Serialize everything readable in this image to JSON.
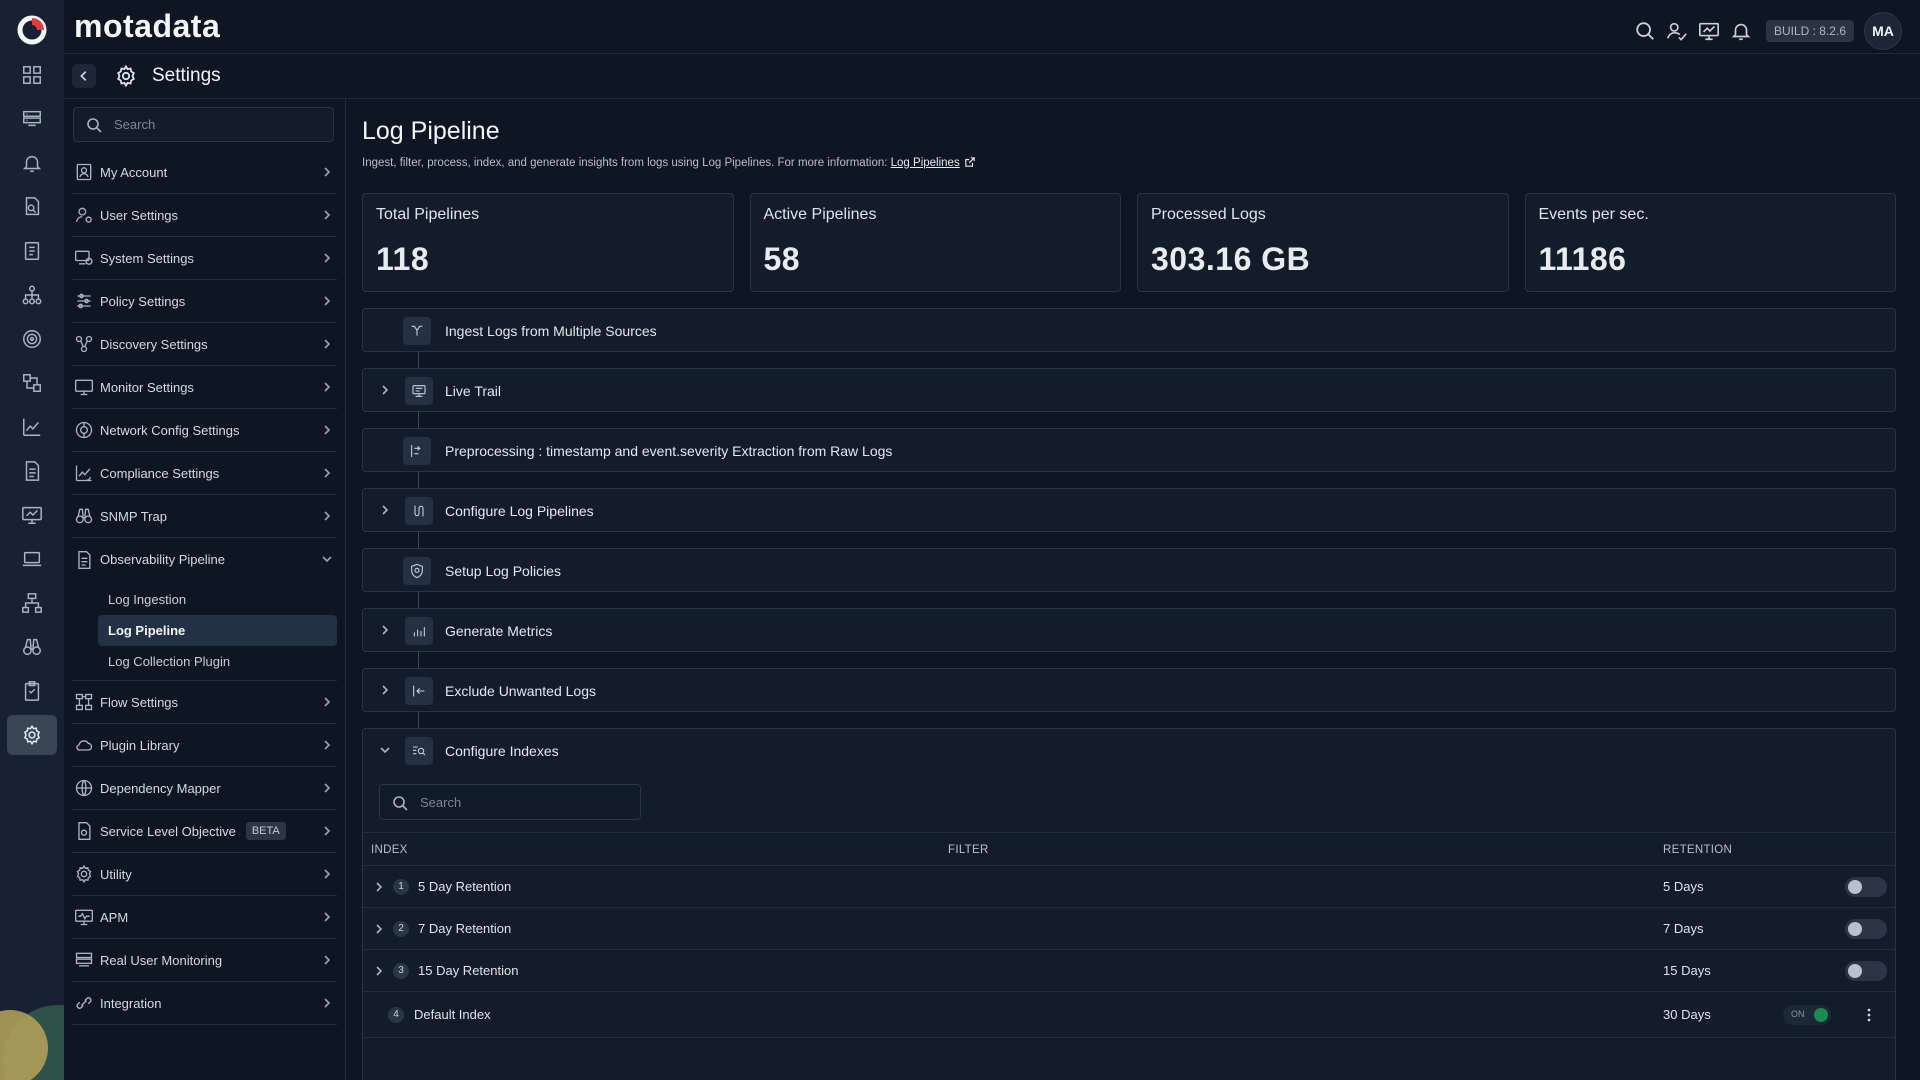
{
  "brand": {
    "name": "motadata"
  },
  "topbar": {
    "build": "BUILD : 8.2.6",
    "avatar": "MA"
  },
  "subheader": {
    "title": "Settings"
  },
  "rail": {
    "icons": [
      "apps-grid-icon",
      "server-list-icon",
      "bell-icon",
      "file-search-icon",
      "report-icon",
      "topology-icon",
      "discovery-radar-icon",
      "network-map-icon",
      "chart-icon",
      "document-icon",
      "monitor-chart-icon",
      "laptop-icon",
      "hierarchy-icon",
      "binoculars-icon",
      "clipboard-icon",
      "settings-gear-icon"
    ],
    "active_index": 15
  },
  "sidebar": {
    "search_placeholder": "Search",
    "items": [
      {
        "label": "My Account",
        "icon": "user-card-icon"
      },
      {
        "label": "User Settings",
        "icon": "user-gear-icon"
      },
      {
        "label": "System Settings",
        "icon": "system-gear-icon"
      },
      {
        "label": "Policy Settings",
        "icon": "sliders-icon"
      },
      {
        "label": "Discovery Settings",
        "icon": "discovery-icon"
      },
      {
        "label": "Monitor Settings",
        "icon": "monitor-icon"
      },
      {
        "label": "Network Config Settings",
        "icon": "network-config-icon"
      },
      {
        "label": "Compliance Settings",
        "icon": "compliance-icon"
      },
      {
        "label": "SNMP Trap",
        "icon": "binoculars-icon"
      },
      {
        "label": "Observability Pipeline",
        "icon": "document-icon",
        "expanded": true,
        "children": [
          {
            "label": "Log Ingestion"
          },
          {
            "label": "Log Pipeline",
            "active": true
          },
          {
            "label": "Log Collection Plugin"
          }
        ]
      },
      {
        "label": "Flow Settings",
        "icon": "flow-icon"
      },
      {
        "label": "Plugin Library",
        "icon": "cloud-icon"
      },
      {
        "label": "Dependency Mapper",
        "icon": "globe-icon"
      },
      {
        "label": "Service Level Objective",
        "icon": "slo-icon",
        "badge": "BETA"
      },
      {
        "label": "Utility",
        "icon": "utility-gear-icon"
      },
      {
        "label": "APM",
        "icon": "apm-icon"
      },
      {
        "label": "Real User Monitoring",
        "icon": "rum-icon"
      },
      {
        "label": "Integration",
        "icon": "integration-icon"
      }
    ]
  },
  "page": {
    "title": "Log Pipeline",
    "description": "Ingest, filter, process, index, and generate insights from logs using Log Pipelines. For more information: ",
    "link_text": "Log Pipelines"
  },
  "stats": [
    {
      "label": "Total Pipelines",
      "value": "118"
    },
    {
      "label": "Active Pipelines",
      "value": "58"
    },
    {
      "label": "Processed Logs",
      "value": "303.16 GB"
    },
    {
      "label": "Events per sec.",
      "value": "11186"
    }
  ],
  "steps": [
    {
      "label": "Ingest Logs from Multiple Sources",
      "expandable": false,
      "icon": "ingest-icon"
    },
    {
      "label": "Live Trail",
      "expandable": true,
      "icon": "live-trail-icon"
    },
    {
      "label": "Preprocessing : timestamp and event.severity Extraction from Raw Logs",
      "expandable": false,
      "icon": "preprocess-icon"
    },
    {
      "label": "Configure Log Pipelines",
      "expandable": true,
      "icon": "pipeline-icon"
    },
    {
      "label": "Setup Log Policies",
      "expandable": false,
      "icon": "shield-icon"
    },
    {
      "label": "Generate Metrics",
      "expandable": true,
      "icon": "metrics-bars-icon"
    },
    {
      "label": "Exclude Unwanted Logs",
      "expandable": true,
      "icon": "exclude-icon"
    }
  ],
  "indexes": {
    "label": "Configure Indexes",
    "search_placeholder": "Search",
    "columns": {
      "index": "INDEX",
      "filter": "FILTER",
      "retention": "RETENTION"
    },
    "rows": [
      {
        "num": "1",
        "name": "5 Day Retention",
        "retention": "5 Days",
        "enabled": false
      },
      {
        "num": "2",
        "name": "7 Day Retention",
        "retention": "7 Days",
        "enabled": false
      },
      {
        "num": "3",
        "name": "15 Day Retention",
        "retention": "15 Days",
        "enabled": false
      },
      {
        "num": "4",
        "name": "Default Index",
        "retention": "30 Days",
        "enabled": true,
        "toggle_text": "ON"
      }
    ]
  }
}
